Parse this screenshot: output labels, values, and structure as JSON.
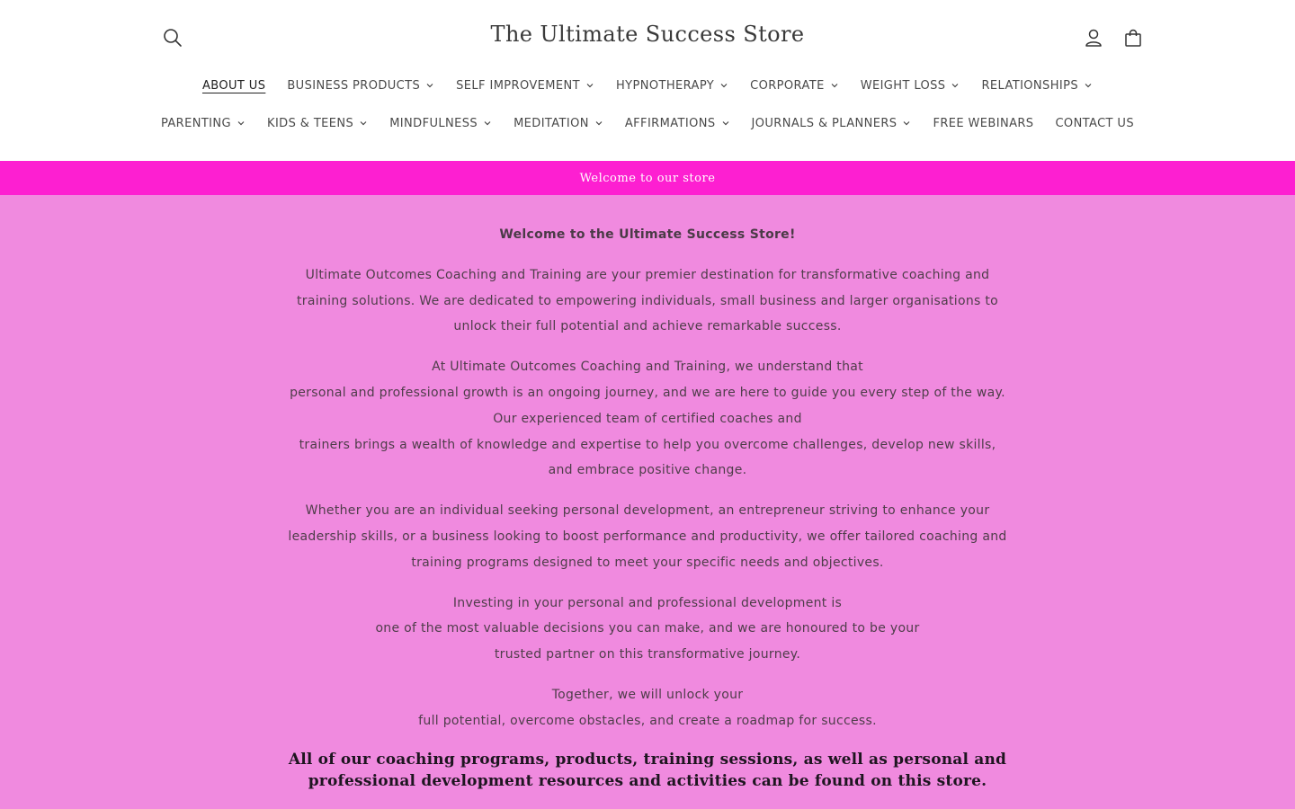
{
  "header": {
    "store_title": "The Ultimate Success Store",
    "icons": {
      "search": "search-icon",
      "account": "user-icon",
      "cart": "bag-icon"
    }
  },
  "nav": {
    "row1": [
      {
        "label": "ABOUT US",
        "dropdown": false,
        "active": true
      },
      {
        "label": "BUSINESS PRODUCTS",
        "dropdown": true
      },
      {
        "label": "SELF IMPROVEMENT",
        "dropdown": true
      },
      {
        "label": "HYPNOTHERAPY",
        "dropdown": true
      },
      {
        "label": "CORPORATE",
        "dropdown": true
      },
      {
        "label": "WEIGHT LOSS",
        "dropdown": true
      },
      {
        "label": "RELATIONSHIPS",
        "dropdown": true
      }
    ],
    "row2": [
      {
        "label": "PARENTING",
        "dropdown": true
      },
      {
        "label": "KIDS & TEENS",
        "dropdown": true
      },
      {
        "label": "MINDFULNESS",
        "dropdown": true
      },
      {
        "label": "MEDITATION",
        "dropdown": true
      },
      {
        "label": "AFFIRMATIONS",
        "dropdown": true
      },
      {
        "label": "JOURNALS & PLANNERS",
        "dropdown": true
      },
      {
        "label": "FREE WEBINARS",
        "dropdown": false
      },
      {
        "label": "CONTACT US",
        "dropdown": false
      }
    ]
  },
  "announcement": {
    "text": "Welcome to our store"
  },
  "main": {
    "heading": "Welcome to the Ultimate Success Store!",
    "paragraphs": [
      [
        "Ultimate Outcomes Coaching and Training are your premier destination for transformative coaching and training solutions. We are dedicated to empowering individuals, small business and larger organisations to unlock their full potential and achieve remarkable success."
      ],
      [
        "At Ultimate Outcomes Coaching and Training, we understand that",
        "personal and professional growth is an ongoing journey, and we are here to guide you every step of the way. Our experienced team of certified coaches and",
        "trainers brings a wealth of knowledge and expertise to help you overcome challenges, develop new skills, and embrace positive change."
      ],
      [
        "Whether you are an individual seeking personal development, an entrepreneur striving to enhance your leadership skills, or a business looking to boost performance and productivity, we offer tailored coaching and training programs designed to meet your specific needs and objectives."
      ],
      [
        "Investing in your personal and professional development is",
        "one of the most valuable decisions you can make, and we are honoured to be your",
        "trusted partner on this transformative journey."
      ],
      [
        "Together, we will unlock your",
        "full potential, overcome obstacles, and create a roadmap for success."
      ]
    ],
    "closing": "All of our coaching programs, products, training sessions, as well as personal and professional development resources and activities can be found on this store."
  },
  "colors": {
    "announcement_bg": "#fd1fd1",
    "main_bg": "#f08adf",
    "header_bg": "#ffffff"
  }
}
